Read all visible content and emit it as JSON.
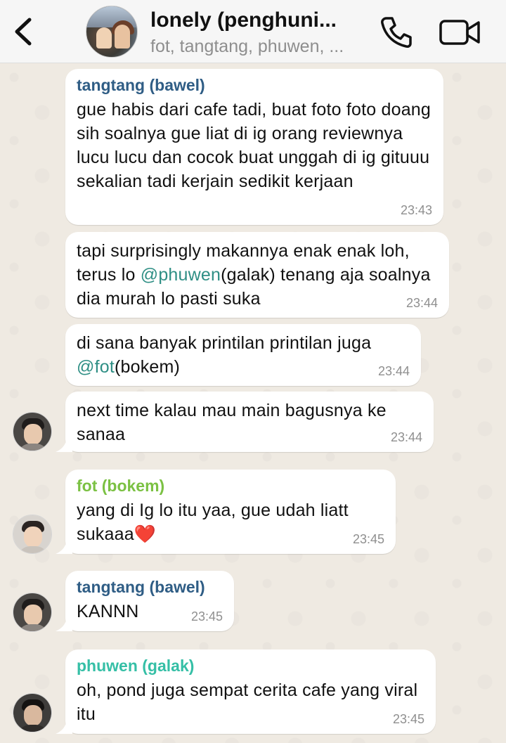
{
  "header": {
    "back_icon": "chevron-left-icon",
    "title": "lonely (penghuni...",
    "subtitle": "fot, tangtang, phuwen, ...",
    "call_icon": "phone-icon",
    "video_icon": "video-camera-icon"
  },
  "colors": {
    "tangtang": "#2f5d85",
    "fot": "#7bc143",
    "phuwen": "#35bfa6",
    "mention": "#2f8f85"
  },
  "messages": [
    {
      "sender": "tangtang (bawel)",
      "text": "gue habis dari cafe tadi, buat foto foto doang sih soalnya gue liat di ig orang reviewnya lucu lucu dan cocok buat unggah di ig gituuu sekalian tadi kerjain sedikit kerjaan",
      "time": "23:43"
    },
    {
      "text_before": "tapi surprisingly makannya enak enak loh, terus lo ",
      "mention": "@phuwen",
      "text_after": "(galak) tenang aja soalnya dia murah lo pasti suka",
      "time": "23:44"
    },
    {
      "text_before": "di sana banyak printilan printilan juga ",
      "mention": "@fot",
      "text_after": "(bokem)",
      "time": "23:44"
    },
    {
      "text": "next time kalau mau main bagusnya ke sanaa",
      "time": "23:44"
    },
    {
      "sender": "fot (bokem)",
      "text": "yang di Ig lo itu yaa, gue udah liatt sukaaa",
      "emoji": "❤️",
      "time": "23:45"
    },
    {
      "sender": "tangtang (bawel)",
      "text": "KANNN",
      "time": "23:45"
    },
    {
      "sender": "phuwen (galak)",
      "text": "oh, pond juga sempat cerita cafe yang viral itu",
      "time": "23:45"
    }
  ]
}
